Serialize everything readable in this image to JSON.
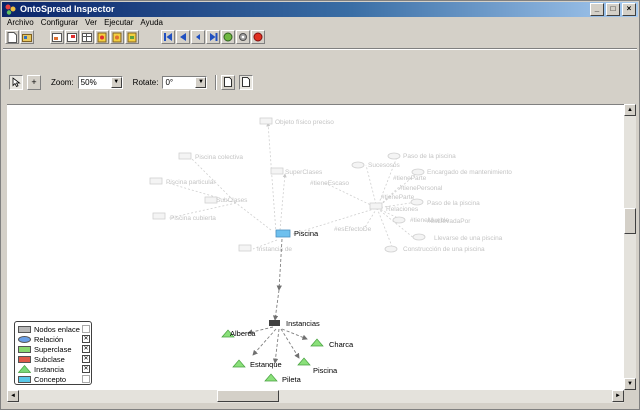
{
  "window": {
    "title": "OntoSpread Inspector"
  },
  "menu": [
    "Archivo",
    "Configurar",
    "Ver",
    "Ejecutar",
    "Ayuda"
  ],
  "toolbar_icons": [
    "new-file-icon",
    "open-file-icon",
    "import-icon",
    "export-icon",
    "table-icon",
    "ontology-icon",
    "query-icon",
    "settings-icon",
    "first-icon",
    "prev-icon",
    "back-icon",
    "next-icon",
    "add-icon",
    "config-icon",
    "stop-icon"
  ],
  "view": {
    "zoom_label": "Zoom:",
    "zoom_value": "50%",
    "rotate_label": "Rotate:",
    "rotate_value": "0°"
  },
  "graph": {
    "center": "Piscina",
    "focus": "Instancias",
    "faded_labels": [
      "Objeto físico preciso",
      "Piscina colectiva",
      "Piscina particular",
      "Piscina cubierta",
      "SubClases",
      "SuperClases",
      "Instancia de",
      "Sucesosos",
      "Paso de la piscina",
      "#tieneEscaso",
      "Encargado de mantenimiento",
      "#tieneParte",
      "#tienePersonal",
      "#tieneParte",
      "Relaciones",
      "Paso de la piscina",
      "#esEfectoDe",
      "#tieneMueble",
      "#esLlevadaPor",
      "Llevarse de una piscina",
      "Construcción de una piscina"
    ],
    "instances": [
      "Alberca",
      "Charca",
      "Estanque",
      "Pileta",
      "Piscina"
    ]
  },
  "legend": [
    {
      "label": "Nodos enlace",
      "color": "#b8b8b8",
      "shape": "rect",
      "checked": false
    },
    {
      "label": "Relación",
      "color": "#6aa0e8",
      "shape": "ellipse",
      "checked": true
    },
    {
      "label": "Superclase",
      "color": "#88d870",
      "shape": "rect",
      "checked": true
    },
    {
      "label": "Subclase",
      "color": "#e05848",
      "shape": "rect",
      "checked": true
    },
    {
      "label": "Instancia",
      "color": "#78d878",
      "shape": "triangle",
      "checked": true
    },
    {
      "label": "Concepto",
      "color": "#58c8e8",
      "shape": "rect",
      "checked": false
    }
  ]
}
